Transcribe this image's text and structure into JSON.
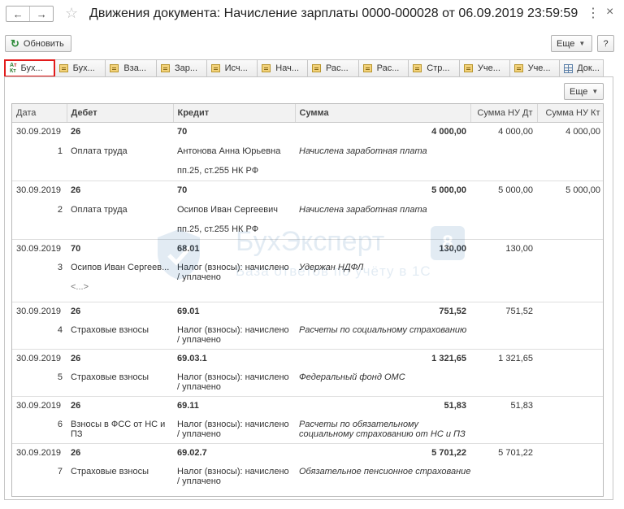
{
  "header": {
    "back": "←",
    "forward": "→",
    "title": "Движения документа: Начисление зарплаты  0000-000028 от 06.09.2019 23:59:59",
    "more": "⋮",
    "close": "×"
  },
  "toolbar": {
    "refresh_label": "Обновить",
    "more_label": "Еще",
    "help_label": "?"
  },
  "tabs": [
    {
      "label": "Бух...",
      "icon": "debit-credit-icon",
      "active": true
    },
    {
      "label": "Бух...",
      "icon": "register-icon"
    },
    {
      "label": "Вза...",
      "icon": "register-icon"
    },
    {
      "label": "Зар...",
      "icon": "register-icon"
    },
    {
      "label": "Исч...",
      "icon": "register-icon"
    },
    {
      "label": "Нач...",
      "icon": "register-icon"
    },
    {
      "label": "Рас...",
      "icon": "register-icon"
    },
    {
      "label": "Рас...",
      "icon": "register-icon"
    },
    {
      "label": "Стр...",
      "icon": "register-icon"
    },
    {
      "label": "Уче...",
      "icon": "register-icon"
    },
    {
      "label": "Уче...",
      "icon": "register-icon"
    },
    {
      "label": "Док...",
      "icon": "table-icon"
    }
  ],
  "panel": {
    "more_label": "Еще"
  },
  "table": {
    "columns": [
      "Дата",
      "Дебет",
      "Кредит",
      "Сумма",
      "Сумма НУ Дт",
      "Сумма НУ Кт"
    ],
    "rows": [
      {
        "date": "30.09.2019",
        "num": "1",
        "debit": "26",
        "debit_sub": "Оплата труда",
        "credit": "70",
        "credit_sub": "Антонова Анна Юрьевна",
        "credit_sub2": "пп.25, ст.255 НК РФ",
        "sum": "4 000,00",
        "content": "Начислена заработная плата",
        "nu_dt": "4 000,00",
        "nu_kt": "4 000,00"
      },
      {
        "date": "30.09.2019",
        "num": "2",
        "debit": "26",
        "debit_sub": "Оплата труда",
        "credit": "70",
        "credit_sub": "Осипов Иван Сергеевич",
        "credit_sub2": "пп.25, ст.255 НК РФ",
        "sum": "5 000,00",
        "content": "Начислена заработная плата",
        "nu_dt": "5 000,00",
        "nu_kt": "5 000,00"
      },
      {
        "date": "30.09.2019",
        "num": "3",
        "debit": "70",
        "debit_sub": "Осипов Иван Сергеев...",
        "debit_sub2": "<...>",
        "credit": "68.01",
        "credit_sub": "Налог (взносы): начислено / уплачено",
        "sum": "130,00",
        "content": "Удержан НДФЛ",
        "nu_dt": "130,00",
        "nu_kt": ""
      },
      {
        "date": "30.09.2019",
        "num": "4",
        "debit": "26",
        "debit_sub": "Страховые взносы",
        "credit": "69.01",
        "credit_sub": "Налог (взносы): начислено / уплачено",
        "sum": "751,52",
        "content": "Расчеты по социальному страхованию",
        "nu_dt": "751,52",
        "nu_kt": ""
      },
      {
        "date": "30.09.2019",
        "num": "5",
        "debit": "26",
        "debit_sub": "Страховые взносы",
        "credit": "69.03.1",
        "credit_sub": "Налог (взносы): начислено / уплачено",
        "sum": "1 321,65",
        "content": "Федеральный фонд ОМС",
        "nu_dt": "1 321,65",
        "nu_kt": ""
      },
      {
        "date": "30.09.2019",
        "num": "6",
        "debit": "26",
        "debit_sub": "Взносы в ФСС от НС и ПЗ",
        "credit": "69.11",
        "credit_sub": "Налог (взносы): начислено / уплачено",
        "sum": "51,83",
        "content": "Расчеты по обязательному социальному страхованию от НС и ПЗ",
        "nu_dt": "51,83",
        "nu_kt": ""
      },
      {
        "date": "30.09.2019",
        "num": "7",
        "debit": "26",
        "debit_sub": "Страховые взносы",
        "credit": "69.02.7",
        "credit_sub": "Налог (взносы): начислено / уплачено",
        "sum": "5 701,22",
        "content": "Обязательное пенсионное страхование",
        "nu_dt": "5 701,22",
        "nu_kt": ""
      }
    ]
  },
  "watermark": {
    "title": "БухЭксперт",
    "badge": "8",
    "subtitle": "База ответов по учёту в 1С"
  }
}
